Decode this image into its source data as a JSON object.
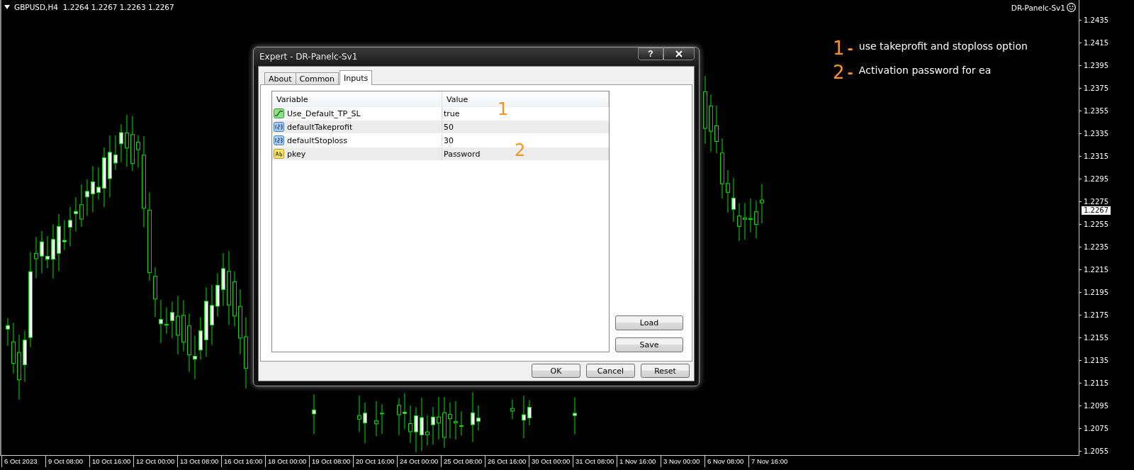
{
  "chart": {
    "symbol_header": "GBPUSD,H4  1.2264 1.2267 1.2263 1.2267",
    "indicator_name": "DR-Panelc-Sv1",
    "price_labels": [
      "1.2435",
      "1.2415",
      "1.2395",
      "1.2375",
      "1.2355",
      "1.2335",
      "1.2315",
      "1.2295",
      "1.2275",
      "1.2255",
      "1.2235",
      "1.2215",
      "1.2195",
      "1.2175",
      "1.2155",
      "1.2135",
      "1.2115",
      "1.2095",
      "1.2075",
      "1.2055"
    ],
    "current_price": "1.2267",
    "time_labels": [
      "6 Oct 2023",
      "9 Oct 08:00",
      "10 Oct 16:00",
      "12 Oct 00:00",
      "13 Oct 08:00",
      "16 Oct 16:00",
      "18 Oct 00:00",
      "19 Oct 08:00",
      "20 Oct 16:00",
      "24 Oct 00:00",
      "25 Oct 08:00",
      "26 Oct 16:00",
      "30 Oct 00:00",
      "31 Oct 08:00",
      "1 Nov 16:00",
      "3 Nov 00:00",
      "6 Nov 08:00",
      "7 Nov 16:00"
    ]
  },
  "notes": [
    {
      "number": "1",
      "dash": "-",
      "text": "use takeprofit and stoploss option"
    },
    {
      "number": "2",
      "dash": "-",
      "text": "Activation password for ea"
    }
  ],
  "dialog": {
    "title": "Expert - DR-Panelc-Sv1",
    "help": "?",
    "tabs": [
      {
        "label": "About",
        "selected": false
      },
      {
        "label": "Common",
        "selected": false
      },
      {
        "label": "Inputs",
        "selected": true
      }
    ],
    "columns": [
      "Variable",
      "Value"
    ],
    "rows": [
      {
        "kind": "bool",
        "variable": "Use_Default_TP_SL",
        "value": "true"
      },
      {
        "kind": "int",
        "variable": "defaultTakeprofit",
        "value": "50"
      },
      {
        "kind": "int",
        "variable": "defaultStoploss",
        "value": "30"
      },
      {
        "kind": "string",
        "variable": "pkey",
        "value": "Password"
      }
    ],
    "markers": [
      "1",
      "2"
    ],
    "side_buttons": [
      "Load",
      "Save"
    ],
    "footer_buttons": [
      "OK",
      "Cancel",
      "Reset"
    ]
  }
}
